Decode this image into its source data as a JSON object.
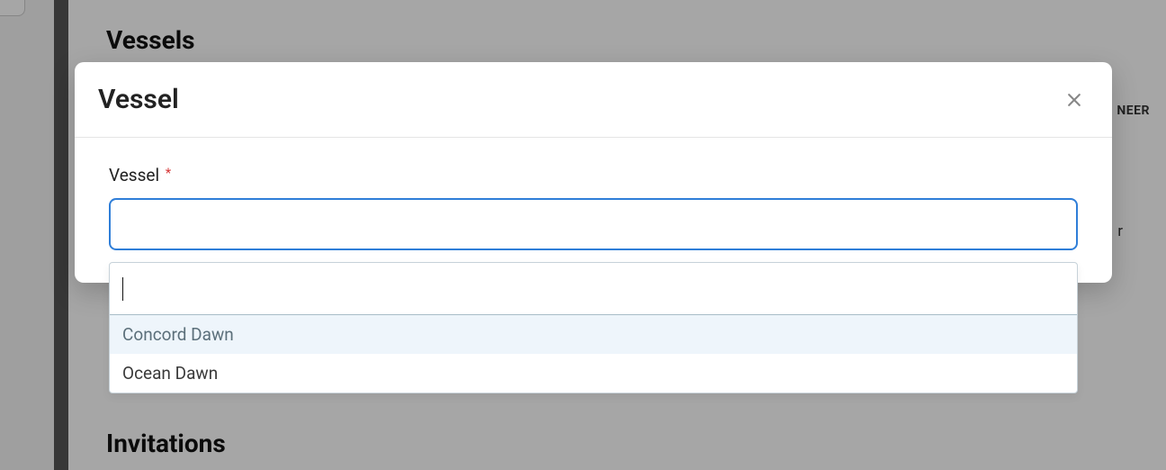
{
  "background": {
    "heading_vessels": "Vessels",
    "heading_invitations": "Invitations",
    "right_header_partial": "NEER",
    "right_cell_partial": "r"
  },
  "modal": {
    "title": "Vessel",
    "field_label": "Vessel",
    "required_mark": "*",
    "select_value": "",
    "search_value": "",
    "options": [
      {
        "label": "Concord Dawn",
        "highlighted": true
      },
      {
        "label": "Ocean Dawn",
        "highlighted": false
      }
    ]
  }
}
